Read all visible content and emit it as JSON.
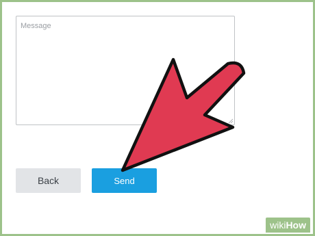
{
  "form": {
    "message_placeholder": "Message",
    "message_value": ""
  },
  "buttons": {
    "back_label": "Back",
    "send_label": "Send"
  },
  "annotation": {
    "arrow_icon": "arrow-pointing-to-send-icon",
    "arrow_color": "#e03a52",
    "outline_color": "#111111"
  },
  "watermark": {
    "brand_prefix": "wiki",
    "brand_suffix": "How"
  },
  "colors": {
    "border_green": "#9dc28a",
    "send_blue": "#1a9fe0",
    "back_gray": "#e2e4e7"
  }
}
